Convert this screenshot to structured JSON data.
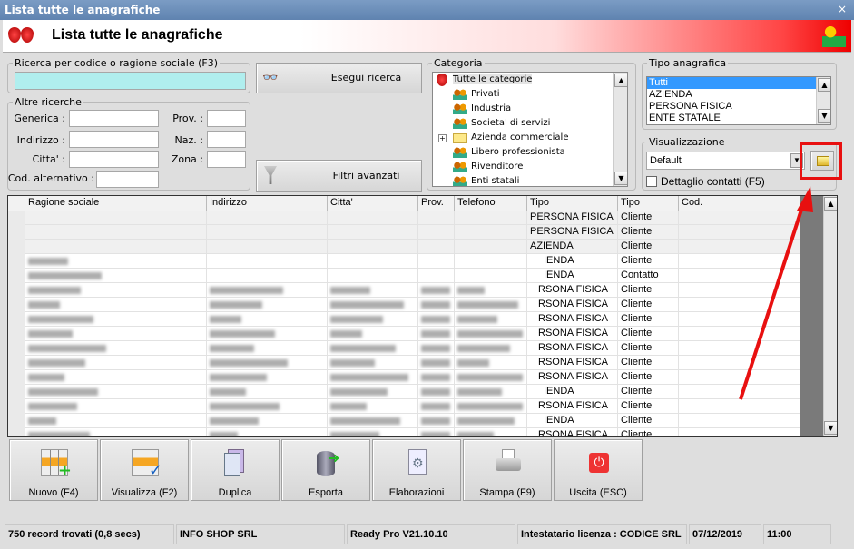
{
  "window": {
    "title": "Lista tutte le anagrafiche",
    "close": "×"
  },
  "header": {
    "title": "Lista tutte le anagrafiche"
  },
  "search": {
    "legend": "Ricerca per codice o ragione sociale (F3)",
    "value": "",
    "button": "Esegui ricerca"
  },
  "other": {
    "legend": "Altre ricerche",
    "generica": "Generica :",
    "indirizzo": "Indirizzo :",
    "citta": "Citta' :",
    "cod_alt": "Cod. alternativo :",
    "prov": "Prov. :",
    "naz": "Naz. :",
    "zona": "Zona :",
    "filters_button": "Filtri avanzati"
  },
  "categoria": {
    "legend": "Categoria",
    "items": [
      "Tutte le categorie",
      "Privati",
      "Industria",
      "Societa' di servizi",
      "Azienda commerciale",
      "Libero professionista",
      "Rivenditore",
      "Enti statali"
    ]
  },
  "tipo": {
    "legend": "Tipo anagrafica",
    "items": [
      "Tutti",
      "AZIENDA",
      "PERSONA FISICA",
      "ENTE STATALE"
    ],
    "selected": "Tutti"
  },
  "vis": {
    "legend": "Visualizzazione",
    "value": "Default",
    "checkbox": "Dettaglio contatti (F5)",
    "checked": false
  },
  "grid": {
    "columns": [
      "Ragione sociale",
      "Indirizzo",
      "Citta'",
      "Prov.",
      "Telefono",
      "Tipo",
      "Tipo",
      "Cod."
    ],
    "rows": [
      {
        "tipo": "PERSONA FISICA",
        "tipo2": "Cliente",
        "blurred": false
      },
      {
        "tipo": "PERSONA FISICA",
        "tipo2": "Cliente",
        "blurred": false
      },
      {
        "tipo": "AZIENDA",
        "tipo2": "Cliente",
        "blurred": false
      },
      {
        "tipo": "IENDA",
        "tipo2": "Cliente",
        "blurred": true
      },
      {
        "tipo": "IENDA",
        "tipo2": "Contatto",
        "blurred": true
      },
      {
        "tipo": "RSONA FISICA",
        "tipo2": "Cliente",
        "blurred": true
      },
      {
        "tipo": "RSONA FISICA",
        "tipo2": "Cliente",
        "blurred": true
      },
      {
        "tipo": "RSONA FISICA",
        "tipo2": "Cliente",
        "blurred": true
      },
      {
        "tipo": "RSONA FISICA",
        "tipo2": "Cliente",
        "blurred": true
      },
      {
        "tipo": "RSONA FISICA",
        "tipo2": "Cliente",
        "blurred": true
      },
      {
        "tipo": "RSONA FISICA",
        "tipo2": "Cliente",
        "blurred": true
      },
      {
        "tipo": "RSONA FISICA",
        "tipo2": "Cliente",
        "blurred": true
      },
      {
        "tipo": "IENDA",
        "tipo2": "Cliente",
        "blurred": true
      },
      {
        "tipo": "RSONA FISICA",
        "tipo2": "Cliente",
        "blurred": true
      },
      {
        "tipo": "IENDA",
        "tipo2": "Cliente",
        "blurred": true
      },
      {
        "tipo": "RSONA FISICA",
        "tipo2": "Cliente",
        "blurred": true
      }
    ]
  },
  "toolbar": [
    {
      "label": "Nuovo (F4)",
      "icon": "grid-add-icon"
    },
    {
      "label": "Visualizza (F2)",
      "icon": "grid-check-icon"
    },
    {
      "label": "Duplica",
      "icon": "duplicate-icon"
    },
    {
      "label": "Esporta",
      "icon": "database-export-icon"
    },
    {
      "label": "Elaborazioni",
      "icon": "gear-document-icon"
    },
    {
      "label": "Stampa (F9)",
      "icon": "printer-icon"
    },
    {
      "label": "Uscita (ESC)",
      "icon": "power-icon"
    }
  ],
  "status": {
    "records": "750 record trovati (0,8 secs)",
    "company": "INFO SHOP SRL",
    "version": "Ready Pro V21.10.10",
    "license": "Intestatario licenza : CODICE SRL",
    "date": "07/12/2019",
    "time": "11:00"
  },
  "colors": {
    "highlight": "#e81010",
    "search_bg": "#b0eeee",
    "selected": "#3399ff"
  }
}
